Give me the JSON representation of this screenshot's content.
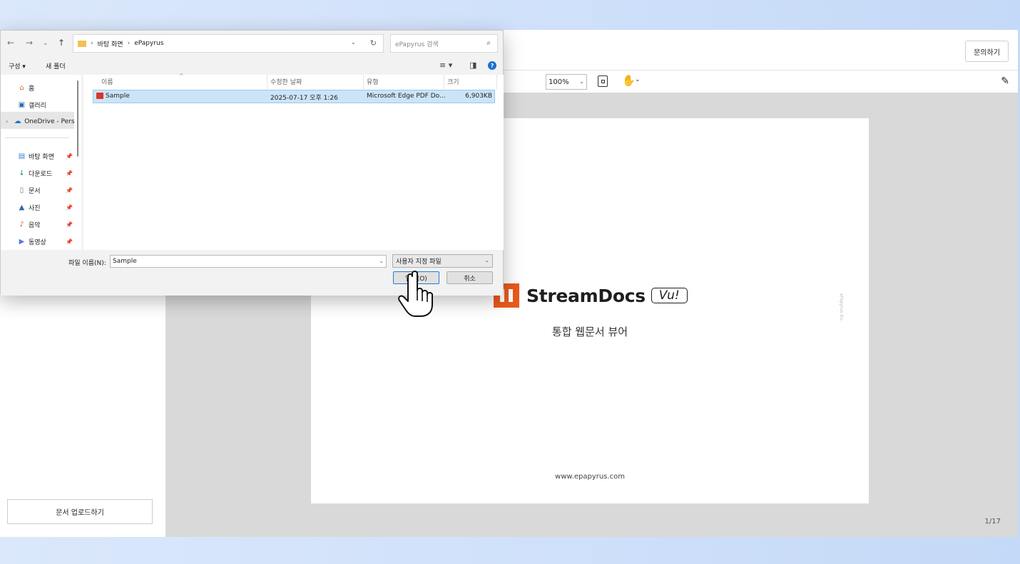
{
  "viewer": {
    "inquiry_label": "문의하기",
    "zoom": "100%",
    "upload_label": "문서 업로드하기",
    "page_indicator": "1/17"
  },
  "document": {
    "brand_name": "StreamDocs",
    "brand_badge": "Vu!",
    "subtitle": "통합 웹문서 뷰어",
    "vertical_text": "ePapyrus Inc.",
    "website": "www.epapyrus.com"
  },
  "dialog": {
    "breadcrumb": [
      "바탕 화면",
      "ePapyrus"
    ],
    "search_placeholder": "ePapyrus 검색",
    "commands": {
      "organize": "구성 ▾",
      "new_folder": "새 폴더"
    },
    "nav_pane": [
      {
        "label": "홈",
        "icon": "home-icon"
      },
      {
        "label": "갤러리",
        "icon": "gallery-icon"
      },
      {
        "label": "OneDrive - Pers",
        "icon": "onedrive-icon"
      },
      {
        "label": "바탕 화면",
        "icon": "desktop-icon",
        "pinned": true
      },
      {
        "label": "다운로드",
        "icon": "download-icon",
        "pinned": true
      },
      {
        "label": "문서",
        "icon": "documents-icon",
        "pinned": true
      },
      {
        "label": "사진",
        "icon": "pictures-icon",
        "pinned": true
      },
      {
        "label": "음악",
        "icon": "music-icon",
        "pinned": true
      },
      {
        "label": "동영상",
        "icon": "video-icon",
        "pinned": true
      }
    ],
    "columns": [
      "이름",
      "수정한 날짜",
      "유형",
      "크기"
    ],
    "files": [
      {
        "name": "Sample",
        "modified": "2025-07-17 오후 1:26",
        "type": "Microsoft Edge PDF Do...",
        "size": "6,903KB"
      }
    ],
    "filename_label": "파일 이름(N):",
    "filename_value": "Sample",
    "filetype": "사용자 지정 파일",
    "open_label": "열기(O)",
    "cancel_label": "취소"
  },
  "colors": {
    "brand_orange": "#ea5a1c",
    "selection": "#cce4f7",
    "accent_blue": "#1f7bd6"
  }
}
